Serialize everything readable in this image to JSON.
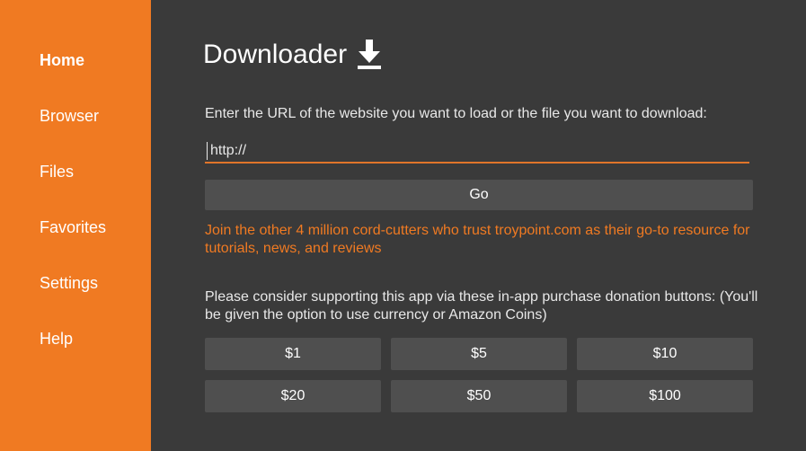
{
  "sidebar": {
    "items": [
      {
        "label": "Home",
        "active": true
      },
      {
        "label": "Browser",
        "active": false
      },
      {
        "label": "Files",
        "active": false
      },
      {
        "label": "Favorites",
        "active": false
      },
      {
        "label": "Settings",
        "active": false
      },
      {
        "label": "Help",
        "active": false
      }
    ]
  },
  "header": {
    "title": "Downloader",
    "icon": "download-icon"
  },
  "main": {
    "prompt": "Enter the URL of the website you want to load or the file you want to download:",
    "url_value": "http://",
    "go_label": "Go",
    "promo_text": "Join the other 4 million cord-cutters who trust troypoint.com as their go-to resource for tutorials, news, and reviews",
    "donate_text": "Please consider supporting this app via these in-app purchase donation buttons: (You'll be given the option to use currency or Amazon Coins)",
    "donations": [
      "$1",
      "$5",
      "$10",
      "$20",
      "$50",
      "$100"
    ]
  },
  "colors": {
    "sidebar_bg": "#f07a22",
    "main_bg": "#3a3a3a",
    "button_bg": "#4f4f4f",
    "accent": "#f07a22"
  }
}
